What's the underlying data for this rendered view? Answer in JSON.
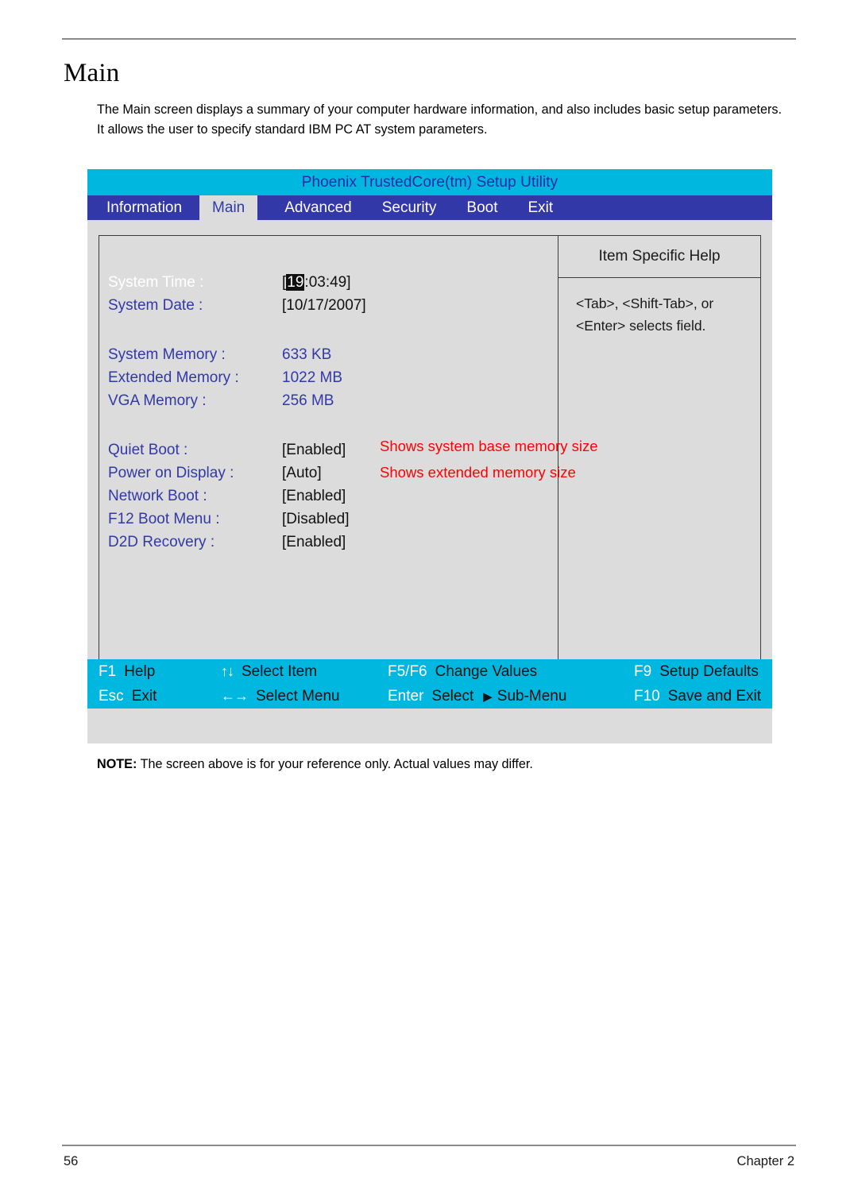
{
  "document": {
    "title": "Main",
    "intro": "The Main screen displays a summary of your computer hardware information, and also includes basic setup parameters. It allows the user to specify standard IBM PC AT system parameters.",
    "note_label": "NOTE:",
    "note_text": " The screen above is for your reference only. Actual values may differ.",
    "page_number": "56",
    "chapter": "Chapter 2"
  },
  "bios": {
    "title": "Phoenix TrustedCore(tm) Setup Utility",
    "tabs": [
      {
        "label": "Information",
        "active": false
      },
      {
        "label": "Main",
        "active": true
      },
      {
        "label": "Advanced",
        "active": false
      },
      {
        "label": "Security",
        "active": false
      },
      {
        "label": "Boot",
        "active": false
      },
      {
        "label": "Exit",
        "active": false
      }
    ],
    "settings": [
      {
        "label": "System Time :",
        "value_pre": "[",
        "value_hl": "19",
        "value_post": ":03:49]",
        "selected": true,
        "value_blue": false
      },
      {
        "label": "System Date :",
        "value": "[10/17/2007]",
        "selected": false,
        "value_blue": false
      },
      {
        "label": "System Memory :",
        "value": "633 KB",
        "selected": false,
        "value_blue": true
      },
      {
        "label": "Extended Memory :",
        "value": "1022 MB",
        "selected": false,
        "value_blue": true
      },
      {
        "label": "VGA Memory :",
        "value": "256 MB",
        "selected": false,
        "value_blue": true
      },
      {
        "label": "Quiet Boot :",
        "value": "[Enabled]",
        "selected": false,
        "value_blue": false
      },
      {
        "label": "Power on Display :",
        "value": "[Auto]",
        "selected": false,
        "value_blue": false
      },
      {
        "label": "Network Boot :",
        "value": "[Enabled]",
        "selected": false,
        "value_blue": false
      },
      {
        "label": "F12 Boot Menu :",
        "value": "[Disabled]",
        "selected": false,
        "value_blue": false
      },
      {
        "label": "D2D Recovery :",
        "value": "[Enabled]",
        "selected": false,
        "value_blue": false
      }
    ],
    "help": {
      "title": "Item Specific Help",
      "line1": "<Tab>, <Shift-Tab>, or",
      "line2": "<Enter> selects field."
    },
    "annotations": [
      "Shows system base memory size",
      "Shows extended memory size"
    ],
    "function_keys": {
      "row1": [
        {
          "key": "F1",
          "text": "Help",
          "glyph": ""
        },
        {
          "key": "",
          "text": "Select Item",
          "glyph": "↑↓"
        },
        {
          "key": "F5/F6",
          "text": "Change Values",
          "glyph": ""
        },
        {
          "key": "F9",
          "text": "Setup Defaults",
          "glyph": ""
        }
      ],
      "row2": [
        {
          "key": "Esc",
          "text": "Exit",
          "glyph": ""
        },
        {
          "key": "",
          "text": "Select Menu",
          "glyph": "←→"
        },
        {
          "key": "Enter",
          "text": "Select",
          "text2": "Sub-Menu",
          "triangle": "▶",
          "glyph": ""
        },
        {
          "key": "F10",
          "text": "Save and Exit",
          "glyph": ""
        }
      ]
    }
  },
  "colors": {
    "cyan": "#00b7e0",
    "tab_blue": "#3338a8",
    "panel_gray": "#dcdcdc",
    "annotation_red": "#ff0000",
    "label_blue": "#3338a8"
  }
}
